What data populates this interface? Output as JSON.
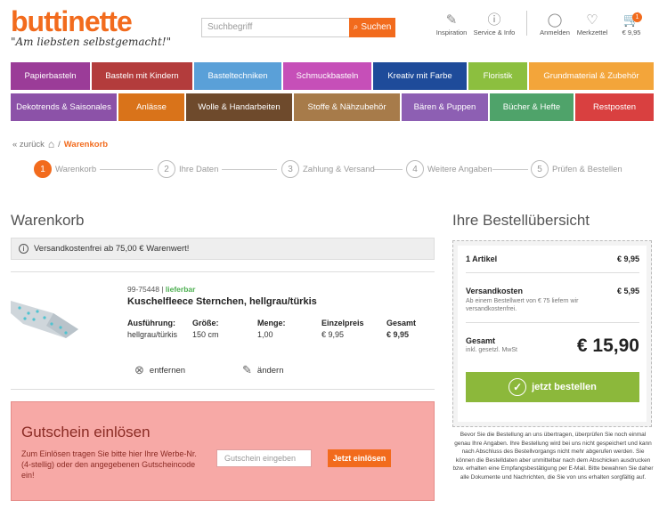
{
  "header": {
    "logo": "buttinette",
    "slogan": "\"Am liebsten selbstgemacht!\"",
    "search_placeholder": "Suchbegriff",
    "search_button": "Suchen",
    "icons": [
      {
        "label": "Inspiration",
        "icon": "inspiration-icon"
      },
      {
        "label": "Service & Info",
        "icon": "info-icon"
      },
      {
        "label": "Anmelden",
        "icon": "user-icon"
      },
      {
        "label": "Merkzettel",
        "icon": "heart-icon"
      },
      {
        "label": "€ 9,95",
        "icon": "cart-icon"
      }
    ],
    "cart_count": "1"
  },
  "nav": {
    "row1": [
      {
        "label": "Papierbasteln",
        "color": "#9b3c98"
      },
      {
        "label": "Basteln mit Kindern",
        "color": "#b33c3c"
      },
      {
        "label": "Basteltechniken",
        "color": "#5aa0d8"
      },
      {
        "label": "Schmuckbasteln",
        "color": "#c64fb8"
      },
      {
        "label": "Kreativ mit Farbe",
        "color": "#1e4b9a"
      },
      {
        "label": "Floristik",
        "color": "#8cbf3f"
      },
      {
        "label": "Grundmaterial & Zubehör",
        "color": "#f3a53a"
      }
    ],
    "row2": [
      {
        "label": "Dekotrends & Saisonales",
        "color": "#8c52a8"
      },
      {
        "label": "Anlässe",
        "color": "#d9731a"
      },
      {
        "label": "Wolle & Handarbeiten",
        "color": "#6e4a2c"
      },
      {
        "label": "Stoffe & Nähzubehör",
        "color": "#a77b4a"
      },
      {
        "label": "Bären & Puppen",
        "color": "#8d5fb3"
      },
      {
        "label": "Bücher & Hefte",
        "color": "#4fa36a"
      },
      {
        "label": "Restposten",
        "color": "#d94040"
      }
    ]
  },
  "breadcrumb": {
    "back": "« zurück",
    "sep": "/",
    "current": "Warenkorb"
  },
  "steps": [
    {
      "num": "1",
      "label": "Warenkorb"
    },
    {
      "num": "2",
      "label": "Ihre Daten"
    },
    {
      "num": "3",
      "label": "Zahlung & Versand"
    },
    {
      "num": "4",
      "label": "Weitere Angaben"
    },
    {
      "num": "5",
      "label": "Prüfen & Bestellen"
    }
  ],
  "cart": {
    "title": "Warenkorb",
    "info": "Versandkostenfrei ab 75,00 € Warenwert!",
    "item": {
      "art_no": "99-75448",
      "sep": "|",
      "stock": "lieferbar",
      "name": "Kuschelfleece Sternchen, hellgrau/türkis",
      "headers": [
        "Ausführung:",
        "Größe:",
        "Menge:",
        "Einzelpreis",
        "Gesamt"
      ],
      "values": [
        "hellgrau/türkis",
        "150 cm",
        "1,00",
        "€ 9,95",
        "€ 9,95"
      ],
      "remove": "entfernen",
      "edit": "ändern"
    }
  },
  "voucher": {
    "title": "Gutschein einlösen",
    "text": "Zum Einlösen tragen Sie bitte hier Ihre Werbe-Nr. (4-stellig) oder den angegebenen Gutscheincode ein!",
    "placeholder": "Gutschein eingeben",
    "button": "Jetzt einlösen"
  },
  "summary": {
    "title": "Ihre Bestellübersicht",
    "items_label": "1 Artikel",
    "items_value": "€ 9,95",
    "shipping_label": "Versandkosten",
    "shipping_value": "€ 5,95",
    "shipping_note": "Ab einem Bestellwert von € 75 liefern wir versandkostenfrei.",
    "total_label": "Gesamt",
    "total_note": "inkl. gesetzl. MwSt",
    "total_value": "€ 15,90",
    "order_button": "jetzt bestellen",
    "legal": "Bevor Sie die Bestellung an uns übertragen, überprüfen Sie noch einmal genau Ihre Angaben. Ihre Bestellung wird bei uns nicht gespeichert und kann nach Abschluss des Bestellvorgangs nicht mehr abgerufen werden. Sie können die Bestelldaten aber unmittelbar nach dem Abschicken ausdrucken bzw. erhalten eine Empfangsbestätigung per E-Mail. Bitte bewahren Sie daher alle Dokumente und Nachrichten, die Sie von uns erhalten sorgfältig auf."
  }
}
